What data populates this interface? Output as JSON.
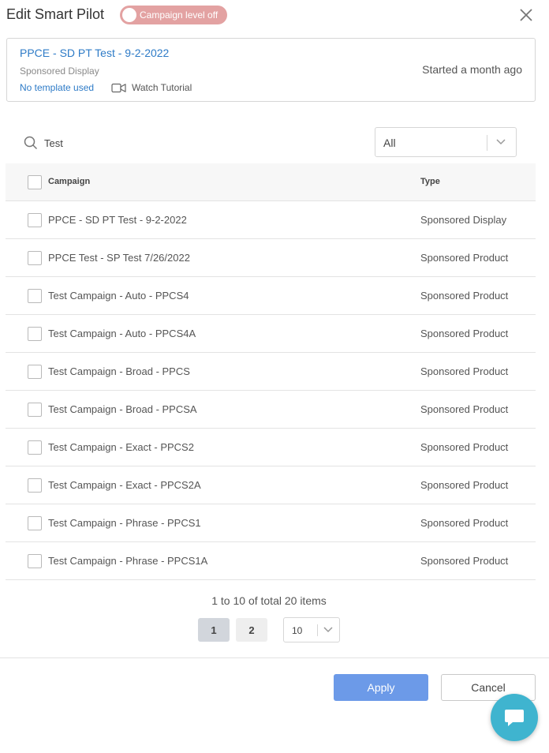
{
  "header": {
    "title": "Edit Smart Pilot",
    "toggle_label": "Campaign level off"
  },
  "info": {
    "campaign_name": "PPCE - SD PT Test - 9-2-2022",
    "campaign_type": "Sponsored Display",
    "template_link": "No template used",
    "tutorial_label": "Watch Tutorial",
    "started": "Started a month ago"
  },
  "search": {
    "value": "Test",
    "icon": "search-icon"
  },
  "filter": {
    "selected": "All"
  },
  "table": {
    "headers": {
      "campaign": "Campaign",
      "type": "Type"
    },
    "rows": [
      {
        "name": "PPCE - SD PT Test - 9-2-2022",
        "type": "Sponsored Display"
      },
      {
        "name": "PPCE Test - SP Test 7/26/2022",
        "type": "Sponsored Product"
      },
      {
        "name": "Test Campaign - Auto - PPCS4",
        "type": "Sponsored Product"
      },
      {
        "name": "Test Campaign - Auto - PPCS4A",
        "type": "Sponsored Product"
      },
      {
        "name": "Test Campaign - Broad - PPCS",
        "type": "Sponsored Product"
      },
      {
        "name": "Test Campaign - Broad - PPCSA",
        "type": "Sponsored Product"
      },
      {
        "name": "Test Campaign - Exact - PPCS2",
        "type": "Sponsored Product"
      },
      {
        "name": "Test Campaign - Exact - PPCS2A",
        "type": "Sponsored Product"
      },
      {
        "name": "Test Campaign - Phrase - PPCS1",
        "type": "Sponsored Product"
      },
      {
        "name": "Test Campaign - Phrase - PPCS1A",
        "type": "Sponsored Product"
      }
    ]
  },
  "pagination": {
    "summary": "1 to 10 of total 20 items",
    "pages": [
      "1",
      "2"
    ],
    "current_page": "1",
    "page_size": "10"
  },
  "footer": {
    "apply_label": "Apply",
    "cancel_label": "Cancel"
  },
  "colors": {
    "accent": "#2e7bc7",
    "toggle_off": "#e3a2a2",
    "apply": "#6c9ae8",
    "chat": "#3fb4cf"
  }
}
